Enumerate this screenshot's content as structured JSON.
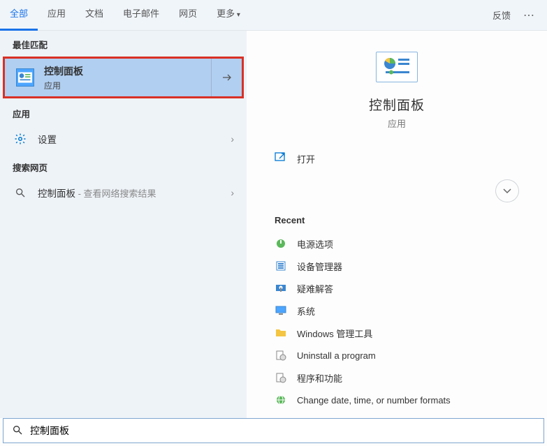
{
  "topbar": {
    "tabs": [
      "全部",
      "应用",
      "文档",
      "电子邮件",
      "网页",
      "更多"
    ],
    "activeIndex": 0,
    "feedback": "反馈"
  },
  "left": {
    "bestMatchHeader": "最佳匹配",
    "bestMatch": {
      "title": "控制面板",
      "subtitle": "应用"
    },
    "appsHeader": "应用",
    "appsItem": {
      "label": "设置"
    },
    "webHeader": "搜索网页",
    "webItem": {
      "prefix": "控制面板",
      "suffix": " - 查看网络搜索结果"
    }
  },
  "right": {
    "title": "控制面板",
    "subtitle": "应用",
    "openLabel": "打开",
    "recentTitle": "Recent",
    "recentItems": [
      {
        "label": "电源选项",
        "icon": "power"
      },
      {
        "label": "设备管理器",
        "icon": "device"
      },
      {
        "label": "疑难解答",
        "icon": "troubleshoot"
      },
      {
        "label": "系统",
        "icon": "system"
      },
      {
        "label": "Windows 管理工具",
        "icon": "folder"
      },
      {
        "label": "Uninstall a program",
        "icon": "programs"
      },
      {
        "label": "程序和功能",
        "icon": "programs"
      },
      {
        "label": "Change date, time, or number formats",
        "icon": "globe"
      }
    ]
  },
  "search": {
    "value": "控制面板"
  }
}
